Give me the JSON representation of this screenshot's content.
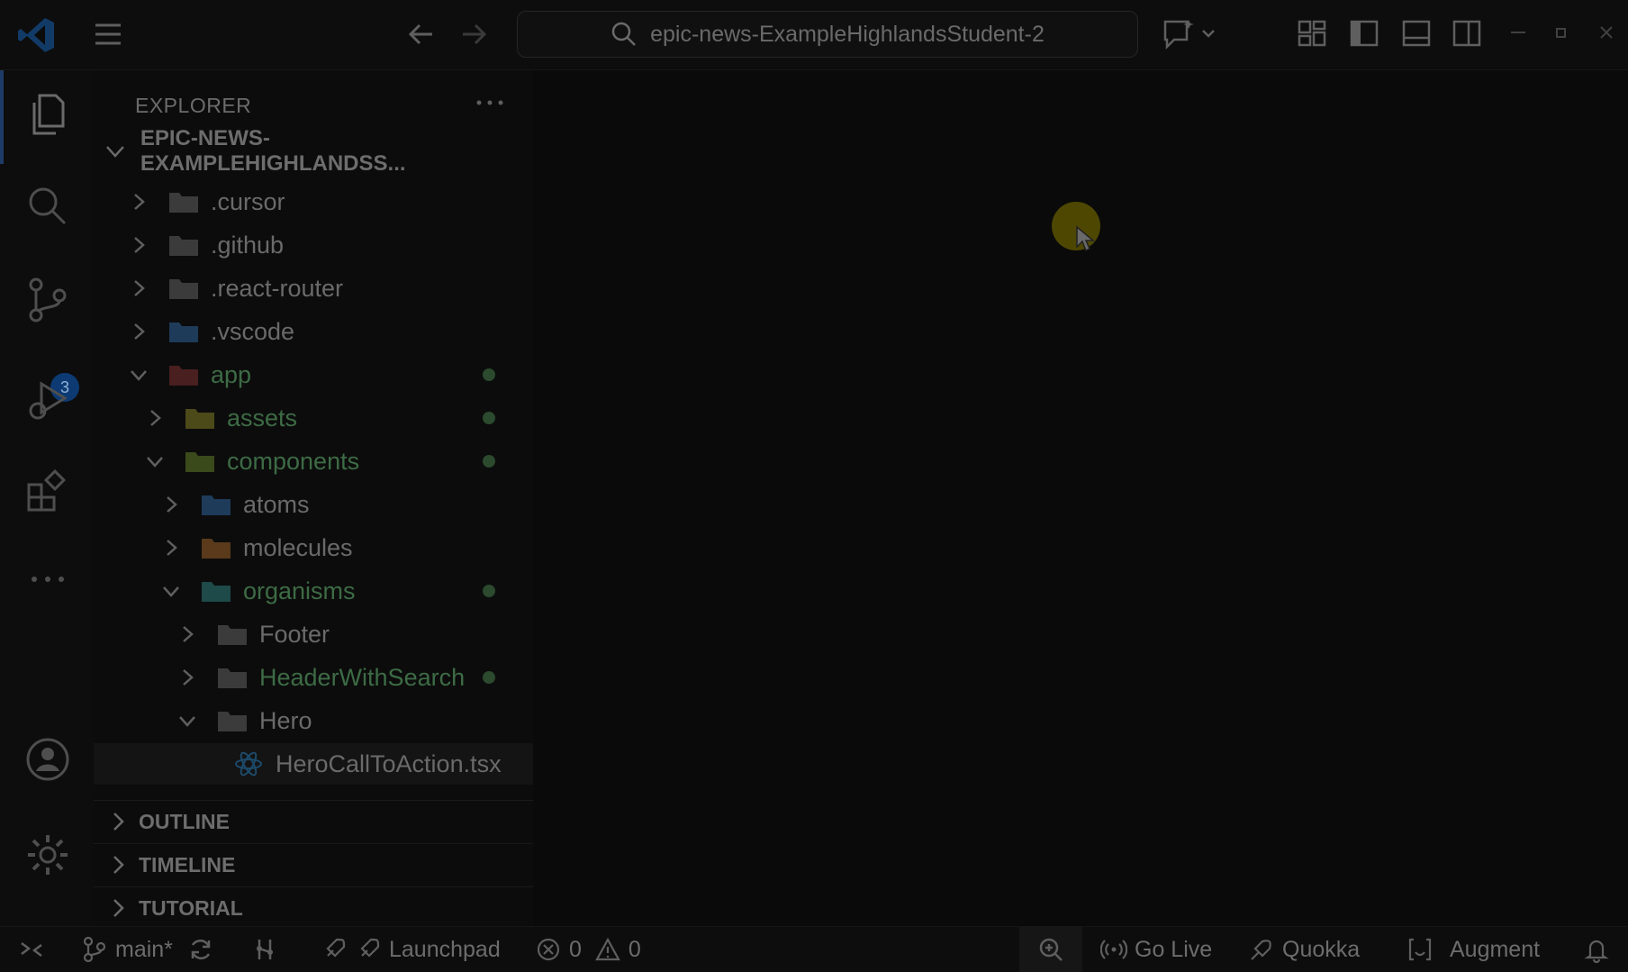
{
  "titlebar": {
    "search_text": "epic-news-ExampleHighlandsStudent-2"
  },
  "activity_bar": {
    "scm_badge": "3"
  },
  "explorer": {
    "title": "EXPLORER",
    "root": "EPIC-NEWS-EXAMPLEHIGHLANDSS...",
    "items": [
      {
        "label": ".cursor",
        "expanded": false,
        "icon": "cursor-folder-icon"
      },
      {
        "label": ".github",
        "expanded": false,
        "icon": "github-folder-icon"
      },
      {
        "label": ".react-router",
        "expanded": false,
        "icon": "folder-icon"
      },
      {
        "label": ".vscode",
        "expanded": false,
        "icon": "vscode-folder-icon"
      },
      {
        "label": "app",
        "expanded": true,
        "icon": "app-folder-icon",
        "modified": true
      },
      {
        "label": "assets",
        "expanded": false,
        "icon": "assets-folder-icon",
        "modified": true
      },
      {
        "label": "components",
        "expanded": true,
        "icon": "components-folder-icon",
        "modified": true
      },
      {
        "label": "atoms",
        "expanded": false,
        "icon": "atoms-folder-icon"
      },
      {
        "label": "molecules",
        "expanded": false,
        "icon": "molecules-folder-icon"
      },
      {
        "label": "organisms",
        "expanded": true,
        "icon": "organisms-folder-icon",
        "modified": true
      },
      {
        "label": "Footer",
        "expanded": false,
        "icon": "folder-icon"
      },
      {
        "label": "HeaderWithSearch",
        "expanded": false,
        "icon": "folder-icon",
        "modified": true
      },
      {
        "label": "Hero",
        "expanded": true,
        "icon": "folder-open-icon"
      },
      {
        "label": "HeroCallToAction.tsx",
        "file": true,
        "icon": "react-file-icon",
        "selected": true
      }
    ],
    "panels": [
      "OUTLINE",
      "TIMELINE",
      "TUTORIAL"
    ]
  },
  "statusbar": {
    "branch": "main*",
    "launchpad": "Launchpad",
    "errors": "0",
    "warnings": "0",
    "go_live": "Go Live",
    "quokka": "Quokka",
    "augment": "Augment"
  },
  "colors": {
    "background": "#0b0b0b",
    "modified_dot": "#2b4a2e",
    "badge": "#0d3a73",
    "cursor_highlight": "#5a5200"
  }
}
